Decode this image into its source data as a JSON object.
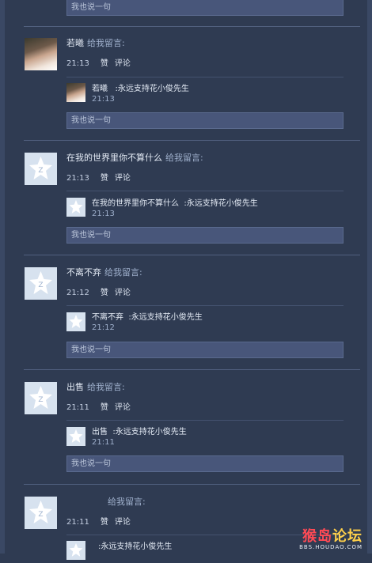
{
  "reply_placeholder": "我也说一句",
  "hint": "给我留言:",
  "like": "赞",
  "comment": "评论",
  "reply_prefix": ":",
  "messages": [
    {
      "name": "若曦",
      "time": "21:13",
      "reply_name": "若曦",
      "reply_text": "永远支持花小俊先生",
      "reply_time": "21:13"
    },
    {
      "name": "在我的世界里你不算什么",
      "time": "21:13",
      "reply_name": "在我的世界里你不算什么",
      "reply_text": "永远支持花小俊先生",
      "reply_time": "21:13"
    },
    {
      "name": "不离不弃",
      "time": "21:12",
      "reply_name": "不离不弃",
      "reply_text": "永远支持花小俊先生",
      "reply_time": "21:12"
    },
    {
      "name": "出售",
      "time": "21:11",
      "reply_name": "出售",
      "reply_text": "永远支持花小俊先生",
      "reply_time": "21:11"
    },
    {
      "name": "",
      "time": "21:11",
      "reply_name": "",
      "reply_text": "永远支持花小俊先生",
      "reply_time": ""
    }
  ],
  "watermark": {
    "part1": "猴岛",
    "part2": "论坛",
    "url": "BBS.HOUDAO.COM"
  }
}
